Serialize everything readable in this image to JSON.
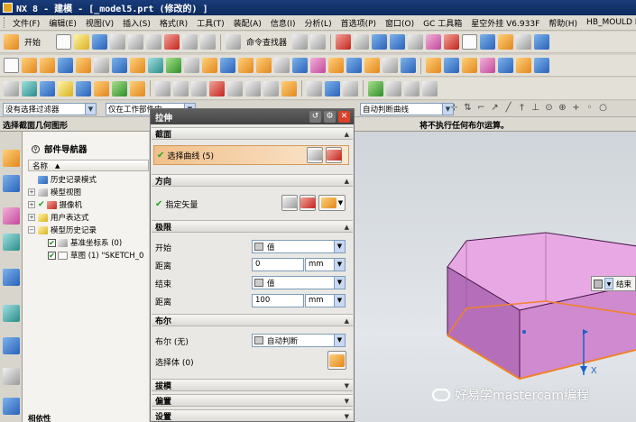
{
  "window": {
    "title": "NX 8 - 建模 - [_model5.prt  (修改的) ]"
  },
  "menu": [
    "文件(F)",
    "编辑(E)",
    "视图(V)",
    "插入(S)",
    "格式(R)",
    "工具(T)",
    "装配(A)",
    "信息(I)",
    "分析(L)",
    "首选项(P)",
    "窗口(O)",
    "GC 工具箱",
    "星空外挂 V6.933F",
    "帮助(H)",
    "HB_MOULD M6.6"
  ],
  "toolbar": {
    "start_label": "开始",
    "command_finder_label": "命令查找器"
  },
  "filters": {
    "type_filter": "没有选择过滤器",
    "scope_filter": "仅在工作部件内",
    "curve_rule": "自动判断曲线"
  },
  "status": {
    "prompt": "选择截面几何图形",
    "message": "将不执行任何布尔运算。"
  },
  "navigator": {
    "title": "部件导航器",
    "column_name": "名称",
    "items": [
      {
        "label": "历史记录模式",
        "level": 0
      },
      {
        "label": "模型视图",
        "level": 0
      },
      {
        "label": "摄像机",
        "level": 0
      },
      {
        "label": "用户表达式",
        "level": 0
      },
      {
        "label": "模型历史记录",
        "level": 0
      },
      {
        "label": "基准坐标系 (0)",
        "level": 1
      },
      {
        "label": "草图 (1) \"SKETCH_0",
        "level": 1
      }
    ],
    "footer": "相依性"
  },
  "dialog": {
    "title": "拉伸",
    "section": {
      "header": "截面",
      "select_curve": "选择曲线 (5)"
    },
    "direction": {
      "header": "方向",
      "specify_vector": "指定矢量"
    },
    "limits": {
      "header": "极限",
      "start_label": "开始",
      "start_type": "值",
      "start_distance_label": "距离",
      "start_distance": "0",
      "start_unit": "mm",
      "end_label": "结束",
      "end_type": "值",
      "end_distance_label": "距离",
      "end_distance": "100",
      "end_unit": "mm"
    },
    "boolean": {
      "header": "布尔",
      "label": "布尔 (无)",
      "value": "自动判断",
      "select_body": "选择体 (0)"
    },
    "draft": {
      "header": "拔模"
    },
    "offset": {
      "header": "偏置"
    },
    "settings": {
      "header": "设置"
    }
  },
  "graphics": {
    "end_handle_label": "结束",
    "axis_label": "X",
    "model_colors": {
      "top": "#e8a8e4",
      "front": "#d08ad0",
      "side": "#b56fba",
      "edge": "#4a1a4a",
      "highlight": "#f0822a",
      "axis": "#1b5fc7"
    }
  },
  "watermark": "好易学mastercam编程"
}
